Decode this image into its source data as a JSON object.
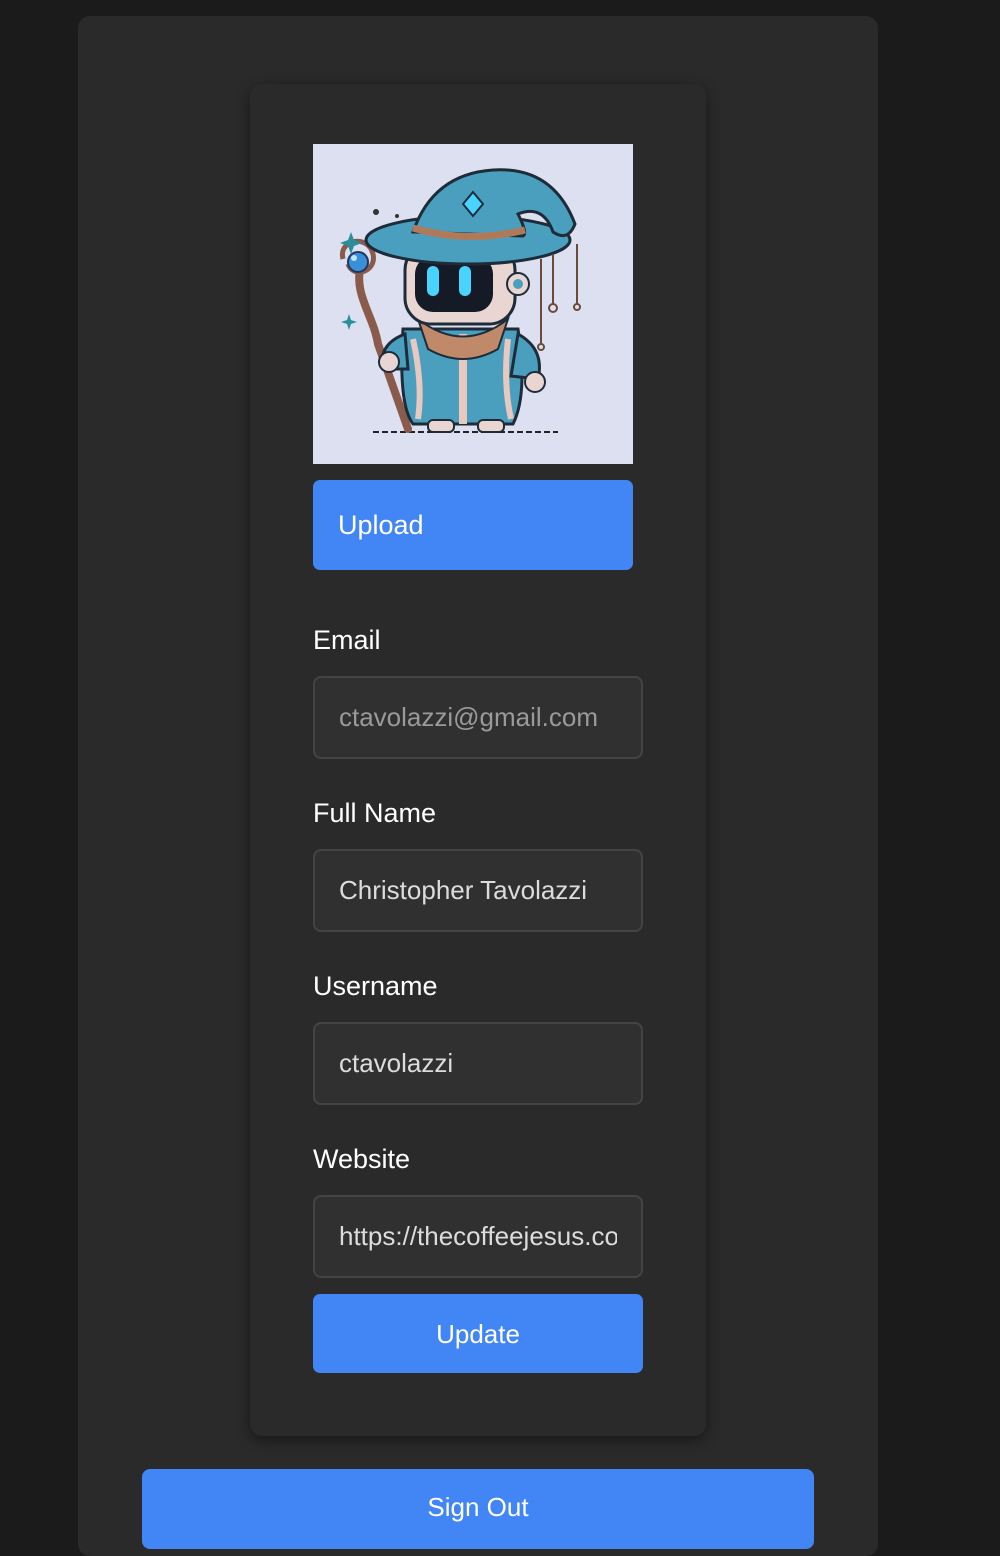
{
  "profile": {
    "avatar_alt": "robot-wizard-avatar",
    "upload_label": "Upload",
    "fields": {
      "email": {
        "label": "Email",
        "value": "ctavolazzi@gmail.com",
        "disabled": true
      },
      "full_name": {
        "label": "Full Name",
        "value": "Christopher Tavolazzi"
      },
      "username": {
        "label": "Username",
        "value": "ctavolazzi"
      },
      "website": {
        "label": "Website",
        "value": "https://thecoffeejesus.com"
      }
    },
    "update_label": "Update"
  },
  "signout_label": "Sign Out",
  "colors": {
    "page_bg": "#1b1b1b",
    "panel_bg": "#2a2a2a",
    "input_bg": "#303030",
    "input_border": "#444444",
    "accent": "#4285f4",
    "text": "#ffffff"
  }
}
